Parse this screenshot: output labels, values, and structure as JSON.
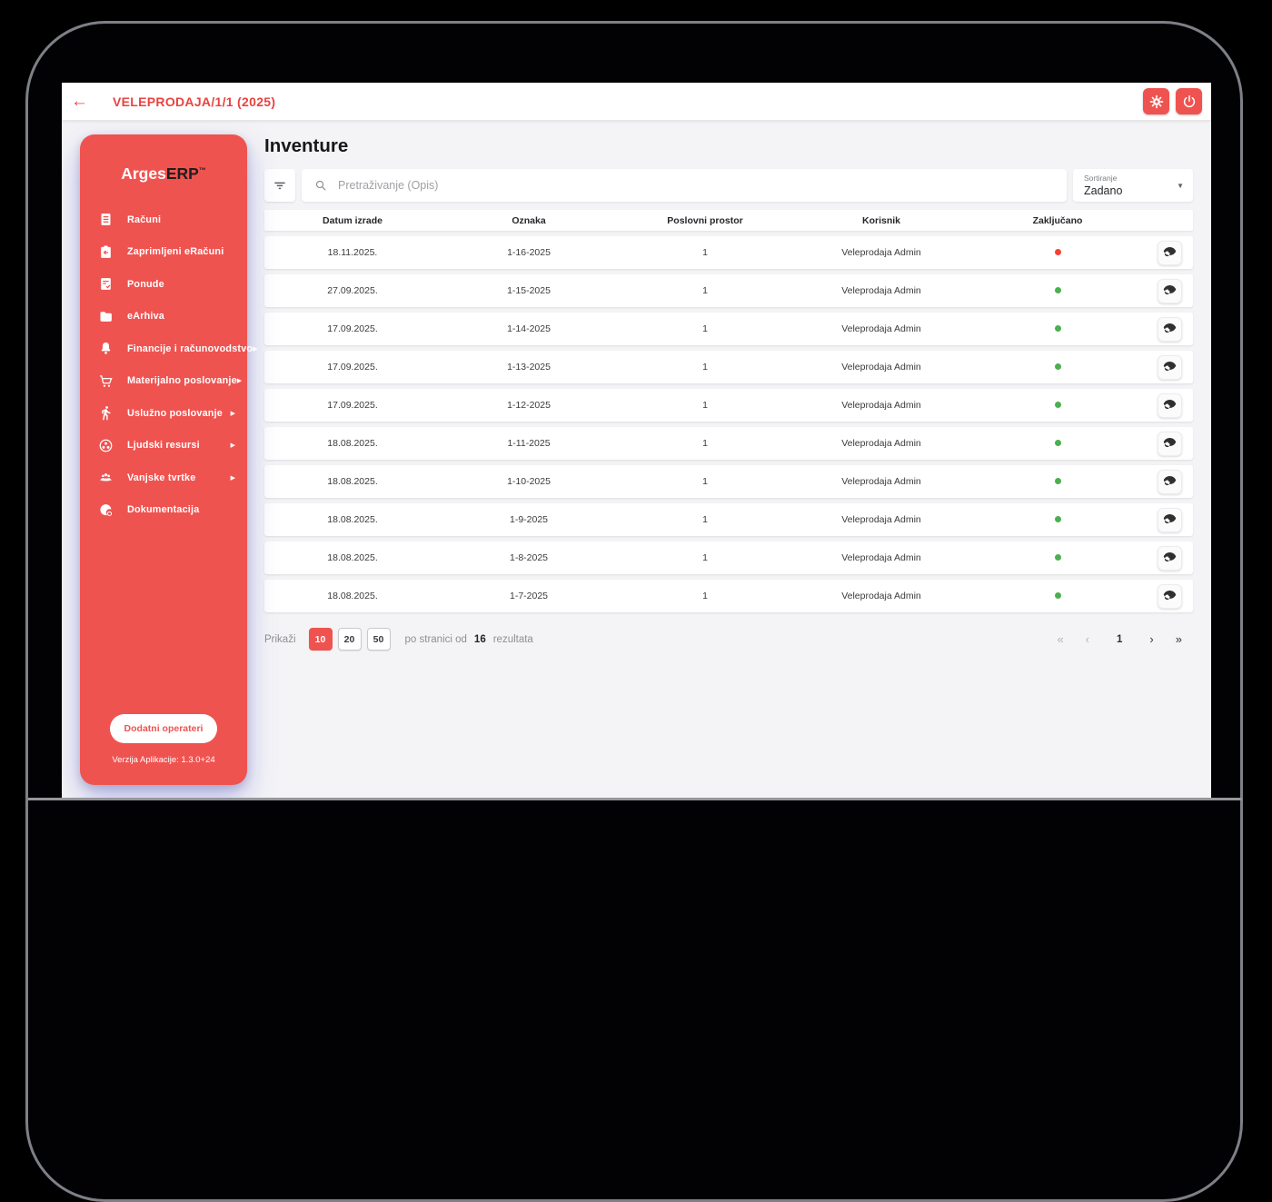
{
  "colors": {
    "accent": "#ef5350",
    "topbar_text": "#e8433f",
    "status_red": "#f44336",
    "status_green": "#4caf50"
  },
  "icons": {
    "back": "←",
    "expand": "▶",
    "dropdown": "▼"
  },
  "topbar": {
    "title": "VELEPRODAJA/1/1 (2025)"
  },
  "sidebar": {
    "logo": {
      "part1": "Arges",
      "part2": "ERP",
      "tm": "™"
    },
    "items": [
      {
        "label": "Računi",
        "icon": "invoice-icon",
        "expandable": false
      },
      {
        "label": "Zaprimljeni eRačuni",
        "icon": "received-invoice-icon",
        "expandable": false
      },
      {
        "label": "Ponude",
        "icon": "offers-icon",
        "expandable": false
      },
      {
        "label": "eArhiva",
        "icon": "folder-icon",
        "expandable": false
      },
      {
        "label": "Financije i računovodstvo",
        "icon": "bell-icon",
        "expandable": true
      },
      {
        "label": "Materijalno poslovanje",
        "icon": "cart-icon",
        "expandable": true
      },
      {
        "label": "Uslužno poslovanje",
        "icon": "run-icon",
        "expandable": true
      },
      {
        "label": "Ljudski resursi",
        "icon": "group-work-icon",
        "expandable": true
      },
      {
        "label": "Vanjske tvrtke",
        "icon": "companies-icon",
        "expandable": true
      },
      {
        "label": "Dokumentacija",
        "icon": "docs-icon",
        "expandable": false
      }
    ],
    "footer_button": "Dodatni operateri",
    "version": "Verzija Aplikacije: 1.3.0+24"
  },
  "main": {
    "title": "Inventure",
    "search": {
      "placeholder": "Pretraživanje (Opis)"
    },
    "sort": {
      "label": "Sortiranje",
      "value": "Zadano"
    },
    "table": {
      "columns": [
        "Datum izrade",
        "Oznaka",
        "Poslovni prostor",
        "Korisnik",
        "Zaključano"
      ],
      "rows": [
        {
          "datum": "18.11.2025.",
          "oznaka": "1-16-2025",
          "prostor": "1",
          "korisnik": "Veleprodaja Admin",
          "status": "red"
        },
        {
          "datum": "27.09.2025.",
          "oznaka": "1-15-2025",
          "prostor": "1",
          "korisnik": "Veleprodaja Admin",
          "status": "green"
        },
        {
          "datum": "17.09.2025.",
          "oznaka": "1-14-2025",
          "prostor": "1",
          "korisnik": "Veleprodaja Admin",
          "status": "green"
        },
        {
          "datum": "17.09.2025.",
          "oznaka": "1-13-2025",
          "prostor": "1",
          "korisnik": "Veleprodaja Admin",
          "status": "green"
        },
        {
          "datum": "17.09.2025.",
          "oznaka": "1-12-2025",
          "prostor": "1",
          "korisnik": "Veleprodaja Admin",
          "status": "green"
        },
        {
          "datum": "18.08.2025.",
          "oznaka": "1-11-2025",
          "prostor": "1",
          "korisnik": "Veleprodaja Admin",
          "status": "green"
        },
        {
          "datum": "18.08.2025.",
          "oznaka": "1-10-2025",
          "prostor": "1",
          "korisnik": "Veleprodaja Admin",
          "status": "green"
        },
        {
          "datum": "18.08.2025.",
          "oznaka": "1-9-2025",
          "prostor": "1",
          "korisnik": "Veleprodaja Admin",
          "status": "green"
        },
        {
          "datum": "18.08.2025.",
          "oznaka": "1-8-2025",
          "prostor": "1",
          "korisnik": "Veleprodaja Admin",
          "status": "green"
        },
        {
          "datum": "18.08.2025.",
          "oznaka": "1-7-2025",
          "prostor": "1",
          "korisnik": "Veleprodaja Admin",
          "status": "green"
        }
      ]
    },
    "pagination": {
      "prefix": "Prikaži",
      "page_sizes": [
        "10",
        "20",
        "50"
      ],
      "selected_size": "10",
      "middle": "po stranici od",
      "total": "16",
      "suffix": "rezultata",
      "pager": [
        {
          "glyph": "«",
          "name": "first-page-button",
          "enabled": false,
          "current": false
        },
        {
          "glyph": "‹",
          "name": "prev-page-button",
          "enabled": false,
          "current": false
        },
        {
          "glyph": "1",
          "name": "current-page",
          "enabled": true,
          "current": true
        },
        {
          "glyph": "›",
          "name": "next-page-button",
          "enabled": true,
          "current": false
        },
        {
          "glyph": "»",
          "name": "last-page-button",
          "enabled": true,
          "current": false
        }
      ]
    }
  }
}
